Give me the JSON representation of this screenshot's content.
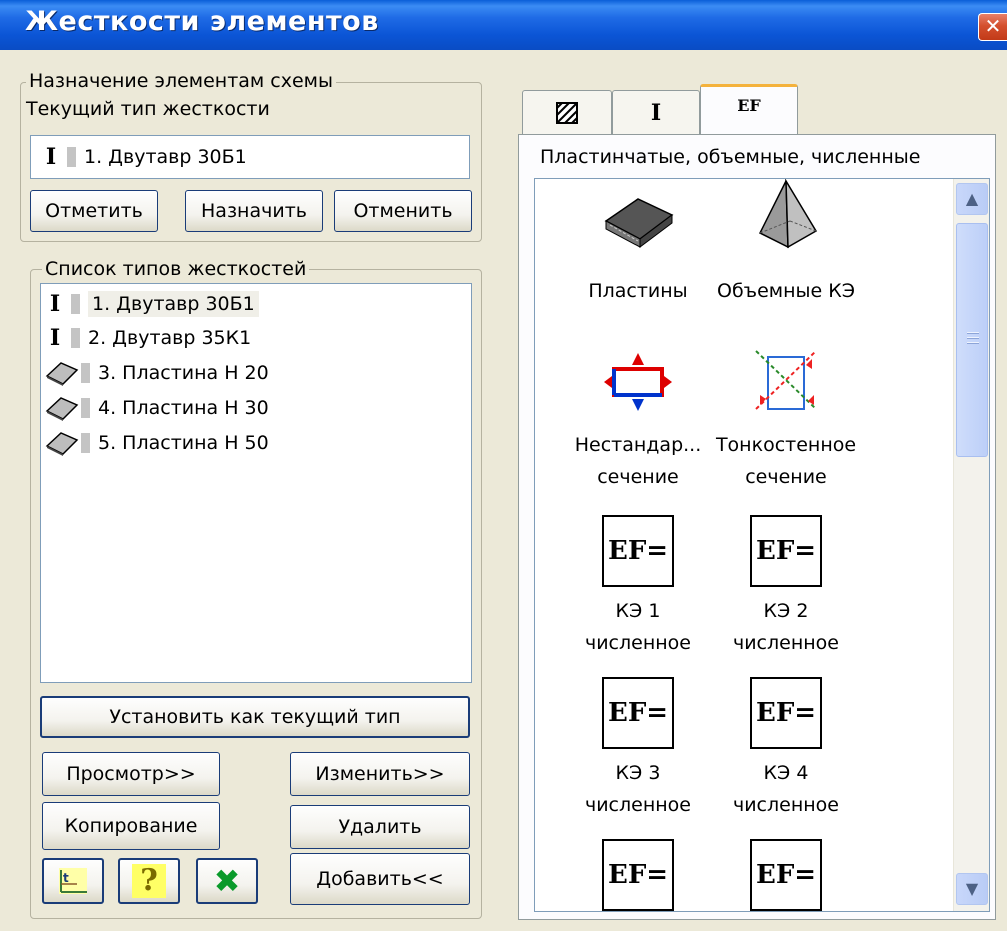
{
  "window": {
    "title": "Жесткости элементов",
    "close_glyph": "✕"
  },
  "assign_group": {
    "legend": "Назначение элементам схемы",
    "current_type_label": "Текущий тип жесткости",
    "current_type_value": "1. Двутавр 30Б1",
    "buttons": {
      "mark": "Отметить",
      "assign": "Назначить",
      "cancel": "Отменить"
    }
  },
  "types_group": {
    "legend": "Список типов жесткостей",
    "items": [
      {
        "icon": "ibeam-icon",
        "label": "1. Двутавр 30Б1",
        "selected": true
      },
      {
        "icon": "ibeam-icon",
        "label": "2. Двутавр 35К1",
        "selected": false
      },
      {
        "icon": "plate-icon",
        "label": "3. Пластина  Н 20",
        "selected": false
      },
      {
        "icon": "plate-icon",
        "label": "4. Пластина  Н 30",
        "selected": false
      },
      {
        "icon": "plate-icon",
        "label": "5. Пластина  Н 50",
        "selected": false
      }
    ],
    "set_current_button": "Установить как текущий тип",
    "buttons": {
      "view": "Просмотр>>",
      "edit": "Изменить>>",
      "copy": "Копирование",
      "delete": "Удалить",
      "add": "Добавить<<"
    }
  },
  "tabs": [
    {
      "name": "hatch-tab",
      "icon": "hatch-icon",
      "active": false
    },
    {
      "name": "ibeam-tab",
      "icon": "ibeam-icon",
      "active": false
    },
    {
      "name": "ef-tab",
      "label": "EF",
      "active": true
    }
  ],
  "tab_panel": {
    "heading": "Пластинчатые, объемные, численные",
    "ef_glyph": "EF=",
    "items": [
      {
        "label1": "Пластины",
        "label2": ""
      },
      {
        "label1": "Объемные КЭ",
        "label2": ""
      },
      {
        "label1": "Нестандар...",
        "label2": "сечение"
      },
      {
        "label1": "Тонкостенное",
        "label2": "сечение"
      },
      {
        "label1": "КЭ 1",
        "label2": "численное"
      },
      {
        "label1": "КЭ 2",
        "label2": "численное"
      },
      {
        "label1": "КЭ 3",
        "label2": "численное"
      },
      {
        "label1": "КЭ 4",
        "label2": "численное"
      }
    ]
  },
  "ibeam_glyph": "I",
  "help_glyph": "?",
  "close_x_glyph": "✖",
  "colors": {
    "title_bar": "#0b55d6",
    "close": "#d4502e",
    "dialog_bg": "#ece9d8",
    "tab_accent": "#f4b23c"
  }
}
